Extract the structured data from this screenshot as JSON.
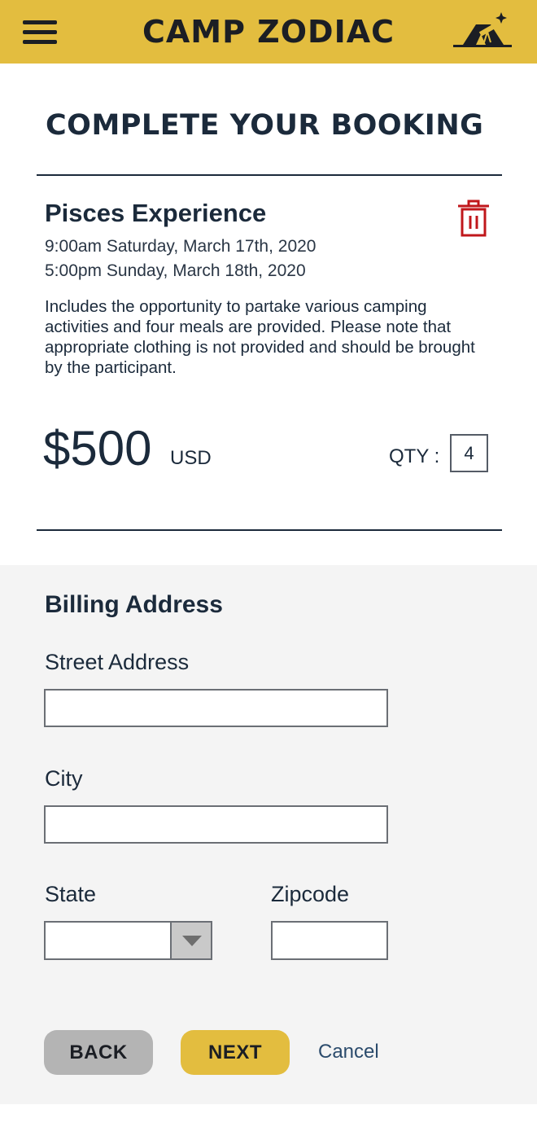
{
  "header": {
    "brand": "CAMP ZODIAC",
    "menu_icon": "hamburger-menu-icon",
    "logo_icon": "tent-telescope-icon",
    "brand_color": "#e3bd3f"
  },
  "page": {
    "title": "COMPLETE YOUR BOOKING"
  },
  "booking": {
    "name": "Pisces Experience",
    "start": "9:00am Saturday, March 17th, 2020",
    "end": "5:00pm Sunday, March 18th, 2020",
    "description": "Includes the opportunity to partake various camping activities and four meals are provided. Please note that appropriate clothing is not provided and should be brought by the participant.",
    "price": "$500",
    "currency": "USD",
    "qty_label": "QTY :",
    "qty_value": "4",
    "delete_icon": "trash-icon",
    "delete_icon_color": "#c0171b"
  },
  "billing": {
    "title": "Billing Address",
    "street_label": "Street Address",
    "street_value": "",
    "city_label": "City",
    "city_value": "",
    "state_label": "State",
    "state_value": "",
    "zip_label": "Zipcode",
    "zip_value": ""
  },
  "actions": {
    "back_label": "BACK",
    "next_label": "NEXT",
    "cancel_label": "Cancel"
  }
}
